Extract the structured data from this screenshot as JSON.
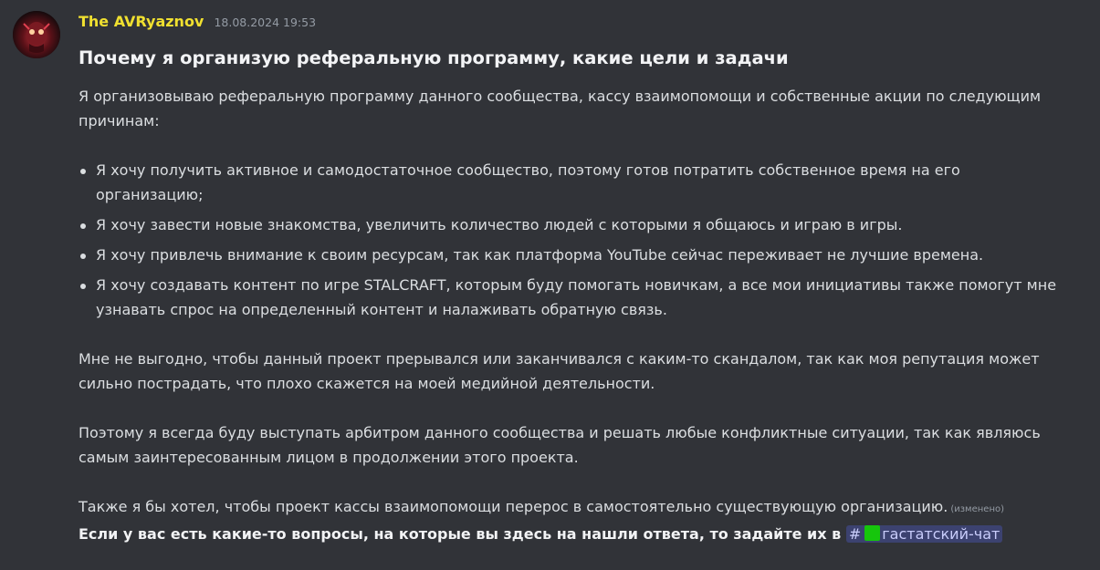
{
  "message": {
    "author": "The AVRyaznov",
    "timestamp": "18.08.2024 19:53",
    "title": "Почему я организую реферальную программу, какие цели и задачи",
    "intro": "Я организовываю реферальную программу данного сообщества, кассу взаимопомощи и собственные акции по следующим причинам:",
    "bullets": [
      "Я хочу получить активное и самодостаточное сообщество, поэтому готов потратить собственное время на его организацию;",
      "Я хочу завести новые знакомства, увеличить количество людей с которыми я общаюсь и играю в игры.",
      "Я хочу привлечь внимание к своим ресурсам, так как платформа YouTube сейчас переживает не лучшие времена.",
      "Я хочу создавать контент по игре STALCRAFT, которым буду помогать новичкам, а все мои инициативы также помогут мне узнавать спрос на определенный контент и налаживать обратную связь."
    ],
    "para1": "Мне не выгодно, чтобы данный проект прерывался или заканчивался с каким-то скандалом, так как моя репутация может сильно пострадать, что плохо скажется на моей медийной деятельности.",
    "para2": "Поэтому я всегда буду выступать арбитром данного сообщества и решать любые конфликтные ситуации, так как являюсь самым заинтересованным лицом в продолжении этого проекта.",
    "para3": "Также я бы хотел, чтобы проект кассы взаимопомощи перерос в самостоятельно существующую организацию.",
    "edited": "(изменено)",
    "final_text": "Если у вас есть какие-то вопросы, на которые вы здесь на нашли ответа, то задайте их в",
    "channel_mention": {
      "hash": "#",
      "name": "гастатский-чат",
      "icon": "green-square-icon",
      "color": "#16c60c"
    }
  },
  "colors": {
    "background": "#313338",
    "username": "#f0e030",
    "mention_bg": "#3c4270"
  }
}
